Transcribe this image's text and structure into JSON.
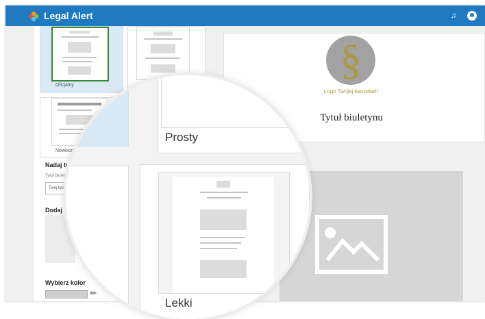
{
  "app": {
    "title": "Legal Alert"
  },
  "templates": [
    {
      "label": "Oficjalny"
    },
    {
      "label": "Prosty"
    },
    {
      "label": "Nowoczesny"
    }
  ],
  "sections": {
    "title_heading": "Nadaj tytuł",
    "title_field_label": "Tytuł biuletynu",
    "title_placeholder": "Twój tytuł",
    "logo_heading": "Dodaj lo",
    "color_heading": "Wybierz kolor"
  },
  "preview": {
    "logo_caption": "Logo Twojej kancelarii",
    "bulletin_title": "Tytuł biuletynu"
  },
  "zoom": {
    "top_label": "Prosty",
    "bottom_label": "Lekki"
  },
  "colors": {
    "topbar": "#1f7ac2",
    "selected_card": "#d9e9f6",
    "selected_outline": "#2e8b2e",
    "logo_gold": "#a89a3f"
  }
}
